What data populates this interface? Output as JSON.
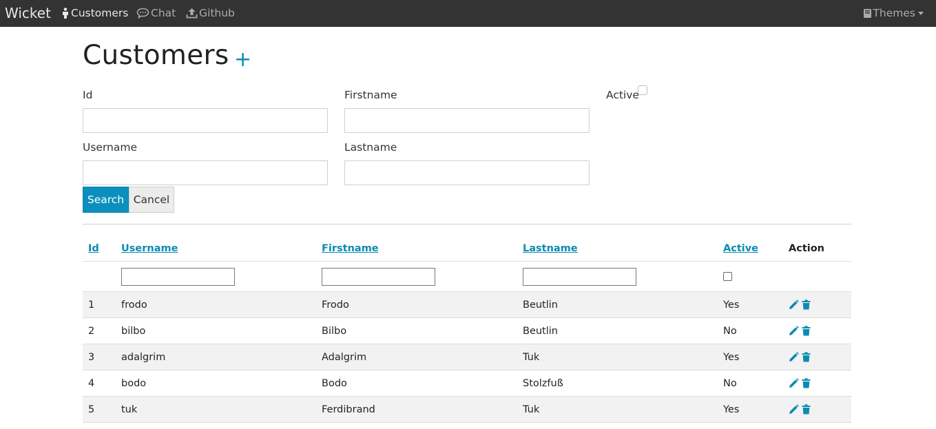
{
  "navbar": {
    "brand": "Wicket",
    "items": [
      {
        "label": "Customers",
        "icon": "person-icon",
        "active": true
      },
      {
        "label": "Chat",
        "icon": "chat-icon",
        "active": false
      },
      {
        "label": "Github",
        "icon": "upload-icon",
        "active": false
      }
    ],
    "themes_label": "Themes"
  },
  "page": {
    "title": "Customers",
    "add_symbol": "+"
  },
  "search_form": {
    "id_label": "Id",
    "firstname_label": "Firstname",
    "active_label": "Active",
    "username_label": "Username",
    "lastname_label": "Lastname",
    "id_value": "",
    "firstname_value": "",
    "username_value": "",
    "lastname_value": "",
    "search_label": "Search",
    "cancel_label": "Cancel"
  },
  "table": {
    "headers": {
      "id": "Id",
      "username": "Username",
      "firstname": "Firstname",
      "lastname": "Lastname",
      "active": "Active",
      "action": "Action"
    },
    "rows": [
      {
        "id": "1",
        "username": "frodo",
        "firstname": "Frodo",
        "lastname": "Beutlin",
        "active": "Yes"
      },
      {
        "id": "2",
        "username": "bilbo",
        "firstname": "Bilbo",
        "lastname": "Beutlin",
        "active": "No"
      },
      {
        "id": "3",
        "username": "adalgrim",
        "firstname": "Adalgrim",
        "lastname": "Tuk",
        "active": "Yes"
      },
      {
        "id": "4",
        "username": "bodo",
        "firstname": "Bodo",
        "lastname": "Stolzfuß",
        "active": "No"
      },
      {
        "id": "5",
        "username": "tuk",
        "firstname": "Ferdibrand",
        "lastname": "Tuk",
        "active": "Yes"
      }
    ]
  },
  "colors": {
    "accent": "#0b8bb3",
    "navbar_bg": "#333333",
    "stripe": "#f2f2f2"
  }
}
